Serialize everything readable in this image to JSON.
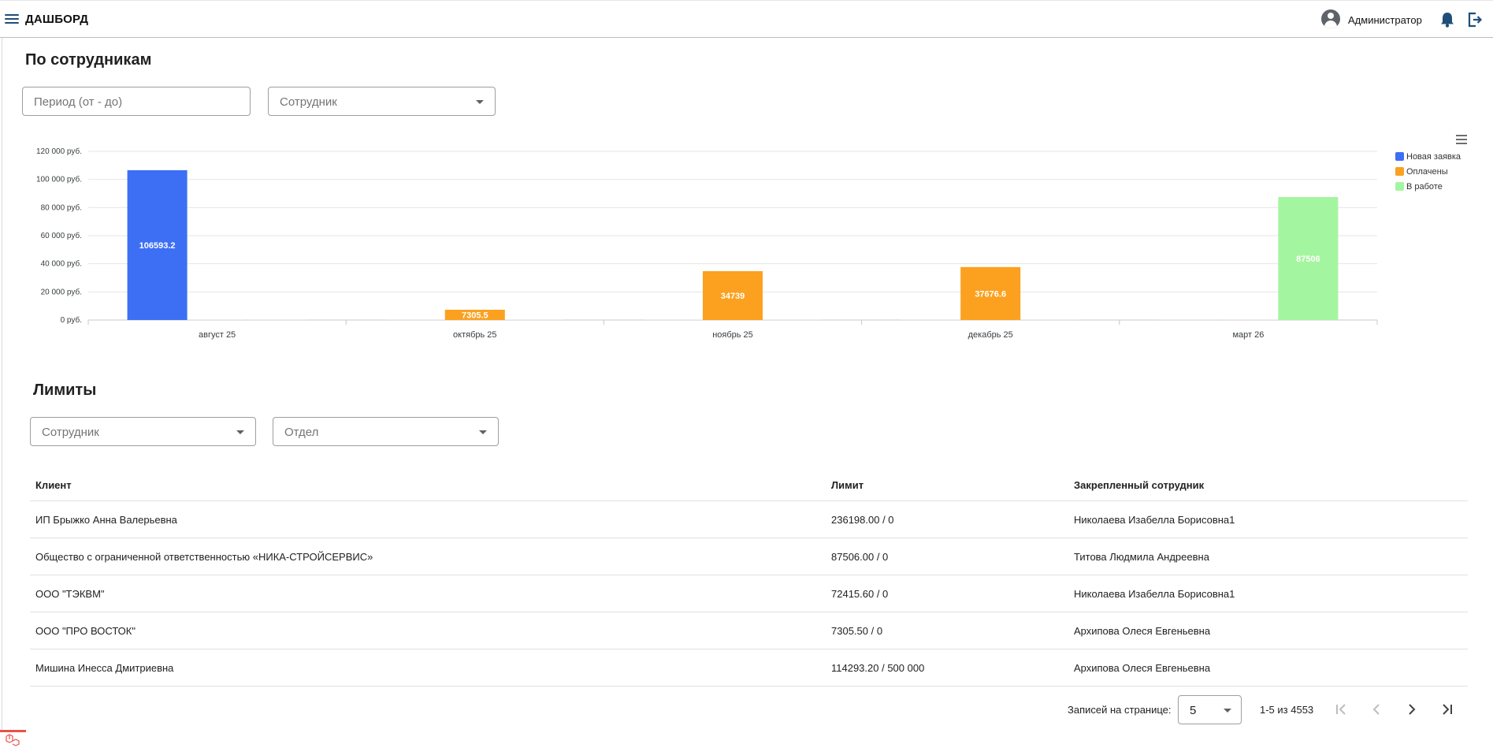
{
  "header": {
    "title": "ДАШБОРД",
    "user_name": "Администратор"
  },
  "employees_section": {
    "title": "По сотрудникам",
    "period_placeholder": "Период (от - до)",
    "employee_placeholder": "Сотрудник"
  },
  "chart_data": {
    "type": "bar",
    "categories": [
      "август 25",
      "октябрь 25",
      "ноябрь 25",
      "декабрь 25",
      "март 26"
    ],
    "series": [
      {
        "name": "Новая заявка",
        "color": "#3d6ff5",
        "values": [
          106593.2,
          0,
          0,
          0,
          0
        ]
      },
      {
        "name": "Оплачены",
        "color": "#fba11f",
        "values": [
          0,
          7305.5,
          34739,
          37676.6,
          0
        ]
      },
      {
        "name": "В работе",
        "color": "#a4f5a0",
        "values": [
          0,
          0,
          0,
          0,
          87506
        ]
      }
    ],
    "data_labels": [
      "106593.2",
      "7305.5",
      "34739",
      "37676.6",
      "87506"
    ],
    "ylim": [
      0,
      120000
    ],
    "yticks": [
      0,
      20000,
      40000,
      60000,
      80000,
      100000,
      120000
    ],
    "ytick_labels": [
      "0 руб.",
      "20 000 руб.",
      "40 000 руб.",
      "60 000 руб.",
      "80 000 руб.",
      "100 000 руб.",
      "120 000 руб."
    ],
    "legend_position": "top-right",
    "grid": true
  },
  "limits_section": {
    "title": "Лимиты",
    "employee_placeholder": "Сотрудник",
    "department_placeholder": "Отдел",
    "columns": [
      "Клиент",
      "Лимит",
      "Закрепленный сотрудник"
    ],
    "rows": [
      [
        "ИП Брыжко Анна Валерьевна",
        "236198.00 / 0",
        "Николаева Изабелла Борисовна1"
      ],
      [
        "Общество с ограниченной ответственностью «НИКА-СТРОЙСЕРВИС»",
        "87506.00 / 0",
        "Титова Людмила Андреевна"
      ],
      [
        "ООО \"ТЭКВМ\"",
        "72415.60 / 0",
        "Николаева Изабелла Борисовна1"
      ],
      [
        "ООО \"ПРО ВОСТОК\"",
        "7305.50 / 0",
        "Архипова Олеся Евгеньевна"
      ],
      [
        "Мишина Инесса Дмитриевна",
        "114293.20 / 500 000",
        "Архипова Олеся Евгеньевна"
      ]
    ]
  },
  "pagination": {
    "rows_label": "Записей на странице:",
    "per_page": "5",
    "range": "1-5 из 4553"
  },
  "icons": {
    "menu": "menu-icon",
    "user": "account-circle-icon",
    "notifications": "bell-icon",
    "logout": "logout-icon",
    "chart_menu": "chart-menu-icon",
    "first_page": "first-page-icon",
    "prev_page": "chevron-left-icon",
    "next_page": "chevron-right-icon",
    "last_page": "last-page-icon"
  }
}
